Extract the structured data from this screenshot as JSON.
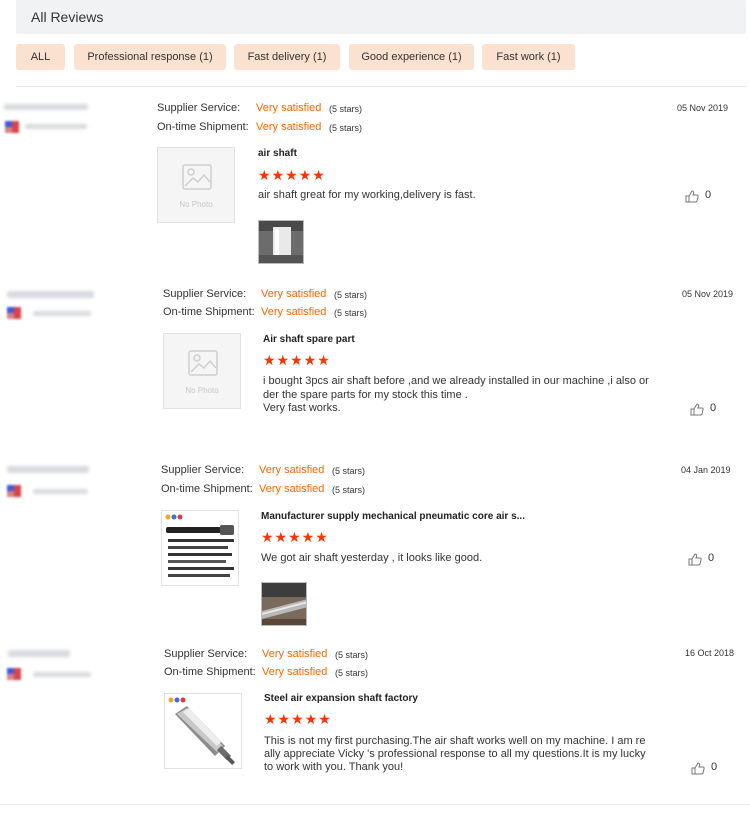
{
  "header": {
    "title": "All Reviews"
  },
  "filters": [
    {
      "label": "ALL"
    },
    {
      "label": "Professional response (1)"
    },
    {
      "label": "Fast delivery (1)"
    },
    {
      "label": "Good experience (1)"
    },
    {
      "label": "Fast work (1)"
    }
  ],
  "rating_labels": {
    "supplier_service": "Supplier Service:",
    "on_time_shipment": "On-time Shipment:"
  },
  "no_photo_text": "No Photo",
  "reviews": [
    {
      "date": "05 Nov 2019",
      "supplier_rating": "Very satisfied",
      "supplier_stars": "(5 stars)",
      "shipment_rating": "Very satisfied",
      "shipment_stars": "(5 stars)",
      "product_title": "air shaft",
      "stars": "★★★★★",
      "text": "air shaft great for my working,delivery is fast.",
      "likes": "0"
    },
    {
      "date": "05 Nov 2019",
      "supplier_rating": "Very satisfied",
      "supplier_stars": "(5 stars)",
      "shipment_rating": "Very satisfied",
      "shipment_stars": "(5 stars)",
      "product_title": "Air shaft spare part",
      "stars": "★★★★★",
      "text_lines": [
        "i bought 3pcs air shaft before ,and we already installed in our machine ,i also or",
        "der the spare parts for my stock this time  .",
        "Very fast works."
      ],
      "likes": "0"
    },
    {
      "date": "04 Jan 2019",
      "supplier_rating": "Very satisfied",
      "supplier_stars": "(5 stars)",
      "shipment_rating": "Very satisfied",
      "shipment_stars": "(5 stars)",
      "product_title": "Manufacturer supply mechanical pneumatic core air s...",
      "stars": "★★★★★",
      "text": "We got air shaft yesterday , it looks like good.",
      "likes": "0"
    },
    {
      "date": "16 Oct 2018",
      "supplier_rating": "Very satisfied",
      "supplier_stars": "(5 stars)",
      "shipment_rating": "Very satisfied",
      "shipment_stars": "(5 stars)",
      "product_title": "Steel air expansion shaft factory",
      "stars": "★★★★★",
      "text_lines": [
        "This is not my first purchasing.The air shaft works well on my machine. I am re",
        "ally appreciate Vicky 's professional response to all my questions.It is my lucky",
        "to work with you. Thank you!"
      ],
      "likes": "0"
    }
  ],
  "colors": {
    "accent": "#ff6600",
    "star": "#ff3300",
    "chip_bg": "#fbe1cf",
    "header_bg": "#f1f2f4"
  }
}
